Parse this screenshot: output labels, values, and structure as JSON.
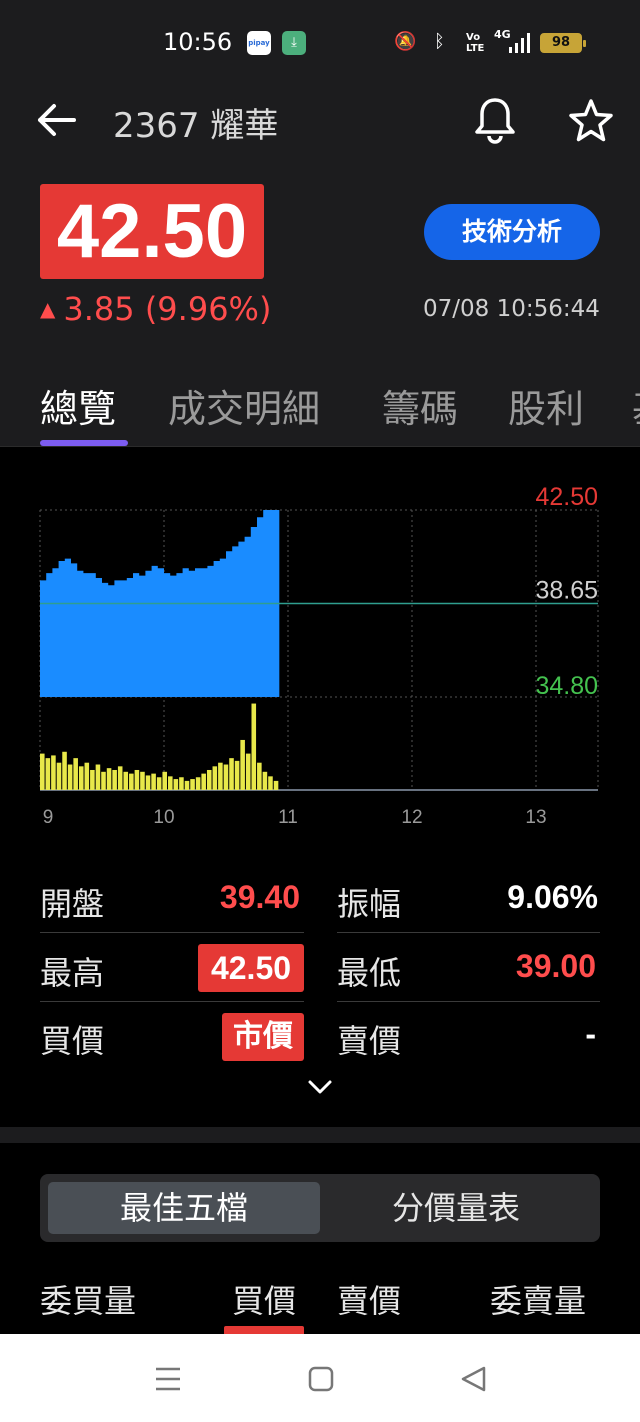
{
  "status_bar": {
    "time": "10:56",
    "app1_label": "pipay",
    "network": "4G",
    "volte": "Vo LTE",
    "battery": "98"
  },
  "header": {
    "title": "2367 耀華",
    "price": "42.50",
    "change": "3.85 (9.96%)",
    "change_arrow": "▲",
    "tech_button": "技術分析",
    "timestamp": "07/08 10:56:44"
  },
  "tabs": [
    "總覽",
    "成交明細",
    "籌碼",
    "股利",
    "基"
  ],
  "colors": {
    "up_red": "#e53935",
    "down_green": "#44c24f",
    "chart_fill": "#1a8cff",
    "volume": "#e8e84a",
    "accent": "#1565e8",
    "tab_indicator": "#7c5cf0"
  },
  "chart_data": {
    "type": "area",
    "y_labels": {
      "high": "42.50",
      "ref": "38.65",
      "low": "34.80"
    },
    "ylim": [
      34.8,
      42.5
    ],
    "reference": 38.65,
    "x_ticks": [
      "9",
      "10",
      "11",
      "12",
      "13"
    ],
    "x_range": [
      9.0,
      13.5
    ],
    "price_series": {
      "x": [
        9.0,
        9.05,
        9.1,
        9.15,
        9.2,
        9.25,
        9.3,
        9.35,
        9.4,
        9.45,
        9.5,
        9.55,
        9.6,
        9.65,
        9.7,
        9.75,
        9.8,
        9.85,
        9.9,
        9.95,
        10.0,
        10.05,
        10.1,
        10.15,
        10.2,
        10.25,
        10.3,
        10.35,
        10.4,
        10.45,
        10.5,
        10.55,
        10.6,
        10.65,
        10.7,
        10.75,
        10.8,
        10.83,
        10.93
      ],
      "y": [
        39.6,
        39.9,
        40.1,
        40.4,
        40.5,
        40.3,
        40.0,
        39.9,
        39.9,
        39.7,
        39.5,
        39.4,
        39.6,
        39.6,
        39.7,
        39.9,
        39.8,
        40.0,
        40.2,
        40.1,
        39.9,
        39.8,
        39.9,
        40.1,
        40.0,
        40.1,
        40.1,
        40.2,
        40.4,
        40.5,
        40.8,
        41.0,
        41.2,
        41.4,
        41.8,
        42.2,
        42.5,
        42.5,
        42.5
      ]
    },
    "volume_series": {
      "ylim": [
        0,
        100
      ],
      "values": [
        40,
        35,
        38,
        30,
        42,
        28,
        35,
        26,
        30,
        22,
        28,
        20,
        24,
        22,
        26,
        20,
        18,
        22,
        20,
        16,
        18,
        14,
        20,
        15,
        12,
        14,
        10,
        12,
        14,
        18,
        22,
        26,
        30,
        28,
        35,
        32,
        55,
        40,
        95,
        30,
        20,
        15,
        10
      ]
    }
  },
  "quote": {
    "rows": [
      {
        "l1": "開盤",
        "v1": "39.40",
        "l2": "振幅",
        "v2": "9.06%"
      },
      {
        "l1": "最高",
        "v1": "42.50",
        "l2": "最低",
        "v2": "39.00"
      },
      {
        "l1": "買價",
        "v1": "市價",
        "l2": "賣價",
        "v2": "-"
      }
    ]
  },
  "order_book": {
    "seg_best5": "最佳五檔",
    "seg_price_vol": "分價量表",
    "headers": [
      "委買量",
      "買價",
      "賣價",
      "委賣量"
    ]
  },
  "nav": {
    "menu_icon": "menu-icon",
    "home_icon": "home-square-icon",
    "back_icon": "back-triangle-icon"
  }
}
